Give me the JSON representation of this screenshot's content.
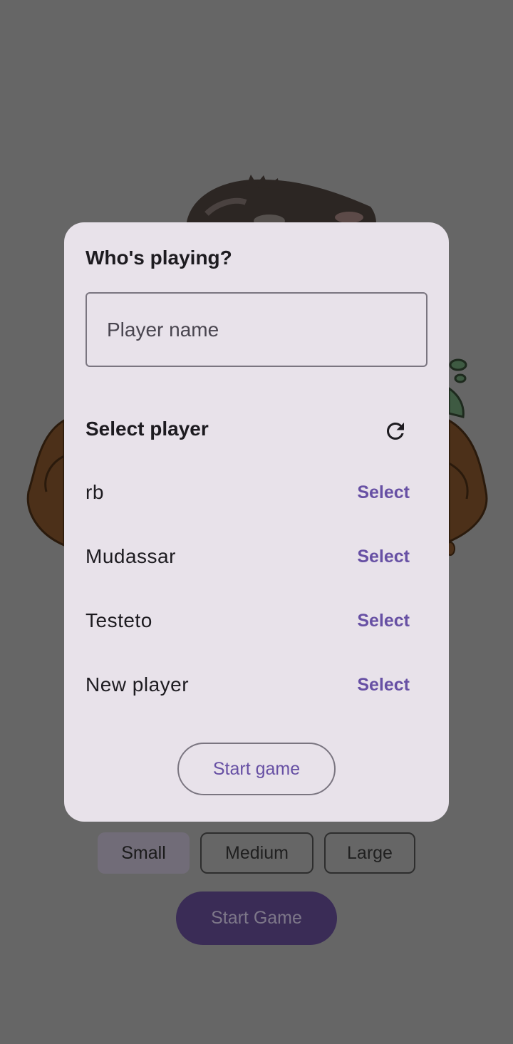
{
  "background": {
    "size_options": [
      "Small",
      "Medium",
      "Large"
    ],
    "selected_size": "Small",
    "start_button_label": "Start Game"
  },
  "dialog": {
    "title": "Who's playing?",
    "name_field": {
      "placeholder": "Player name",
      "value": ""
    },
    "select_header": "Select player",
    "refresh_icon": "refresh-icon",
    "players": [
      {
        "name": "rb",
        "action": "Select"
      },
      {
        "name": "Mudassar",
        "action": "Select"
      },
      {
        "name": "Testeto",
        "action": "Select"
      },
      {
        "name": "New player",
        "action": "Select"
      }
    ],
    "start_label": "Start game"
  },
  "colors": {
    "scrim": "#666666",
    "dialog_bg": "#e8e2ea",
    "accent": "#6750a4",
    "dim_primary": "#3a2c56"
  }
}
